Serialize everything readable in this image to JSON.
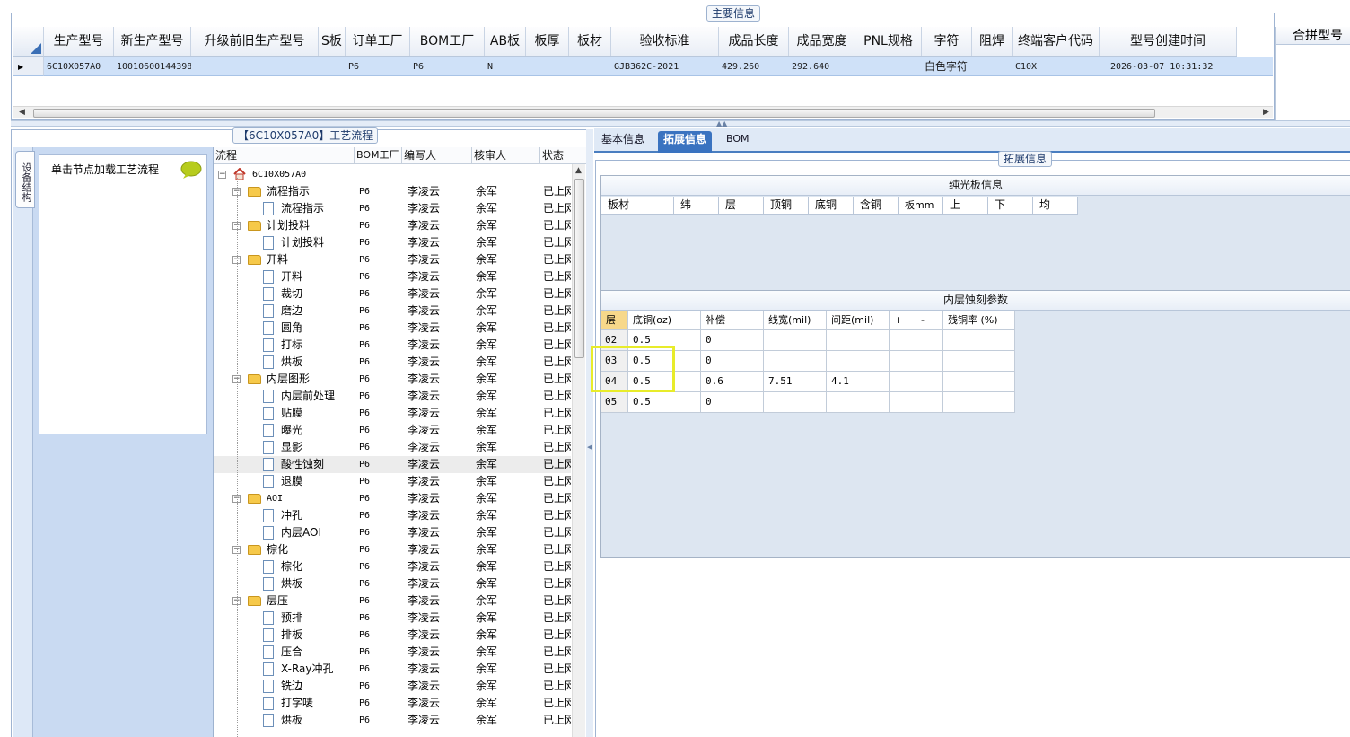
{
  "main_info": {
    "title": "主要信息",
    "columns": [
      "生产型号",
      "新生产型号",
      "升级前旧生产型号",
      "S板",
      "订单工厂",
      "BOM工厂",
      "AB板",
      "板厚",
      "板材",
      "验收标准",
      "成品长度",
      "成品宽度",
      "PNL规格",
      "字符",
      "阻焊",
      "终端客户代码",
      "型号创建时间"
    ],
    "row": [
      "6C10X057A0",
      "10010600144398",
      "",
      "",
      "P6",
      "P6",
      "N",
      "",
      "",
      "GJB362C-2021",
      "429.260",
      "292.640",
      "",
      "白色字符",
      "",
      "C10X",
      "2026-03-07 10:31:32"
    ],
    "merge_title": "合拼型号"
  },
  "nav": {
    "tab_label": "设备结构",
    "hint": "单击节点加载工艺流程"
  },
  "process": {
    "title": "【6C10X057A0】工艺流程",
    "columns": [
      "流程",
      "BOM工厂",
      "编写人",
      "核审人",
      "状态"
    ],
    "root": "6C10X057A0",
    "rows": [
      {
        "name": "流程指示",
        "level": 1,
        "bom": "P6",
        "writer": "李凌云",
        "reviewer": "余军",
        "status": "已上网"
      },
      {
        "name": "流程指示",
        "level": 2,
        "bom": "P6",
        "writer": "李凌云",
        "reviewer": "余军",
        "status": "已上网"
      },
      {
        "name": "计划投料",
        "level": 1,
        "bom": "P6",
        "writer": "李凌云",
        "reviewer": "余军",
        "status": "已上网"
      },
      {
        "name": "计划投料",
        "level": 2,
        "bom": "P6",
        "writer": "李凌云",
        "reviewer": "余军",
        "status": "已上网"
      },
      {
        "name": "开料",
        "level": 1,
        "bom": "P6",
        "writer": "李凌云",
        "reviewer": "余军",
        "status": "已上网"
      },
      {
        "name": "开料",
        "level": 2,
        "bom": "P6",
        "writer": "李凌云",
        "reviewer": "余军",
        "status": "已上网"
      },
      {
        "name": "裁切",
        "level": 2,
        "bom": "P6",
        "writer": "李凌云",
        "reviewer": "余军",
        "status": "已上网"
      },
      {
        "name": "磨边",
        "level": 2,
        "bom": "P6",
        "writer": "李凌云",
        "reviewer": "余军",
        "status": "已上网"
      },
      {
        "name": "圆角",
        "level": 2,
        "bom": "P6",
        "writer": "李凌云",
        "reviewer": "余军",
        "status": "已上网"
      },
      {
        "name": "打标",
        "level": 2,
        "bom": "P6",
        "writer": "李凌云",
        "reviewer": "余军",
        "status": "已上网"
      },
      {
        "name": "烘板",
        "level": 2,
        "bom": "P6",
        "writer": "李凌云",
        "reviewer": "余军",
        "status": "已上网"
      },
      {
        "name": "内层图形",
        "level": 1,
        "bom": "P6",
        "writer": "李凌云",
        "reviewer": "余军",
        "status": "已上网"
      },
      {
        "name": "内层前处理",
        "level": 2,
        "bom": "P6",
        "writer": "李凌云",
        "reviewer": "余军",
        "status": "已上网"
      },
      {
        "name": "贴膜",
        "level": 2,
        "bom": "P6",
        "writer": "李凌云",
        "reviewer": "余军",
        "status": "已上网"
      },
      {
        "name": "曝光",
        "level": 2,
        "bom": "P6",
        "writer": "李凌云",
        "reviewer": "余军",
        "status": "已上网"
      },
      {
        "name": "显影",
        "level": 2,
        "bom": "P6",
        "writer": "李凌云",
        "reviewer": "余军",
        "status": "已上网"
      },
      {
        "name": "酸性蚀刻",
        "level": 2,
        "bom": "P6",
        "writer": "李凌云",
        "reviewer": "余军",
        "status": "已上网",
        "selected": true
      },
      {
        "name": "退膜",
        "level": 2,
        "bom": "P6",
        "writer": "李凌云",
        "reviewer": "余军",
        "status": "已上网"
      },
      {
        "name": "AOI",
        "level": 1,
        "bom": "P6",
        "writer": "李凌云",
        "reviewer": "余军",
        "status": "已上网"
      },
      {
        "name": "冲孔",
        "level": 2,
        "bom": "P6",
        "writer": "李凌云",
        "reviewer": "余军",
        "status": "已上网"
      },
      {
        "name": "内层AOI",
        "level": 2,
        "bom": "P6",
        "writer": "李凌云",
        "reviewer": "余军",
        "status": "已上网"
      },
      {
        "name": "棕化",
        "level": 1,
        "bom": "P6",
        "writer": "李凌云",
        "reviewer": "余军",
        "status": "已上网"
      },
      {
        "name": "棕化",
        "level": 2,
        "bom": "P6",
        "writer": "李凌云",
        "reviewer": "余军",
        "status": "已上网"
      },
      {
        "name": "烘板",
        "level": 2,
        "bom": "P6",
        "writer": "李凌云",
        "reviewer": "余军",
        "status": "已上网"
      },
      {
        "name": "层压",
        "level": 1,
        "bom": "P6",
        "writer": "李凌云",
        "reviewer": "余军",
        "status": "已上网"
      },
      {
        "name": "预排",
        "level": 2,
        "bom": "P6",
        "writer": "李凌云",
        "reviewer": "余军",
        "status": "已上网"
      },
      {
        "name": "排板",
        "level": 2,
        "bom": "P6",
        "writer": "李凌云",
        "reviewer": "余军",
        "status": "已上网"
      },
      {
        "name": "压合",
        "level": 2,
        "bom": "P6",
        "writer": "李凌云",
        "reviewer": "余军",
        "status": "已上网"
      },
      {
        "name": "X-Ray冲孔",
        "level": 2,
        "bom": "P6",
        "writer": "李凌云",
        "reviewer": "余军",
        "status": "已上网"
      },
      {
        "name": "铣边",
        "level": 2,
        "bom": "P6",
        "writer": "李凌云",
        "reviewer": "余军",
        "status": "已上网"
      },
      {
        "name": "打字唛",
        "level": 2,
        "bom": "P6",
        "writer": "李凌云",
        "reviewer": "余军",
        "status": "已上网"
      },
      {
        "name": "烘板",
        "level": 2,
        "bom": "P6",
        "writer": "李凌云",
        "reviewer": "余军",
        "status": "已上网"
      }
    ]
  },
  "detail": {
    "tabs": [
      "基本信息",
      "拓展信息",
      "BOM"
    ],
    "active_tab": "拓展信息",
    "section_title": "拓展信息",
    "plain_board": {
      "title": "纯光板信息",
      "columns": [
        "板材",
        "纬",
        "层",
        "顶铜",
        "底铜",
        "含铜",
        "板mm",
        "上",
        "下",
        "均"
      ]
    },
    "inner_etch": {
      "title": "内层蚀刻参数",
      "columns": [
        "层",
        "底铜(oz)",
        "补偿",
        "线宽(mil)",
        "间距(mil)",
        "+",
        "-",
        "残铜率 (%)"
      ],
      "rows": [
        [
          "02",
          "0.5",
          "0",
          "",
          "",
          "",
          "",
          ""
        ],
        [
          "03",
          "0.5",
          "0",
          "",
          "",
          "",
          "",
          ""
        ],
        [
          "04",
          "0.5",
          "0.6",
          "7.51",
          "4.1",
          "",
          "",
          ""
        ],
        [
          "05",
          "0.5",
          "0",
          "",
          "",
          "",
          "",
          ""
        ]
      ]
    }
  },
  "colors": {
    "accent": "#3a73c0",
    "selected_row": "#cfe1f8",
    "highlight": "#e8ec2a"
  }
}
